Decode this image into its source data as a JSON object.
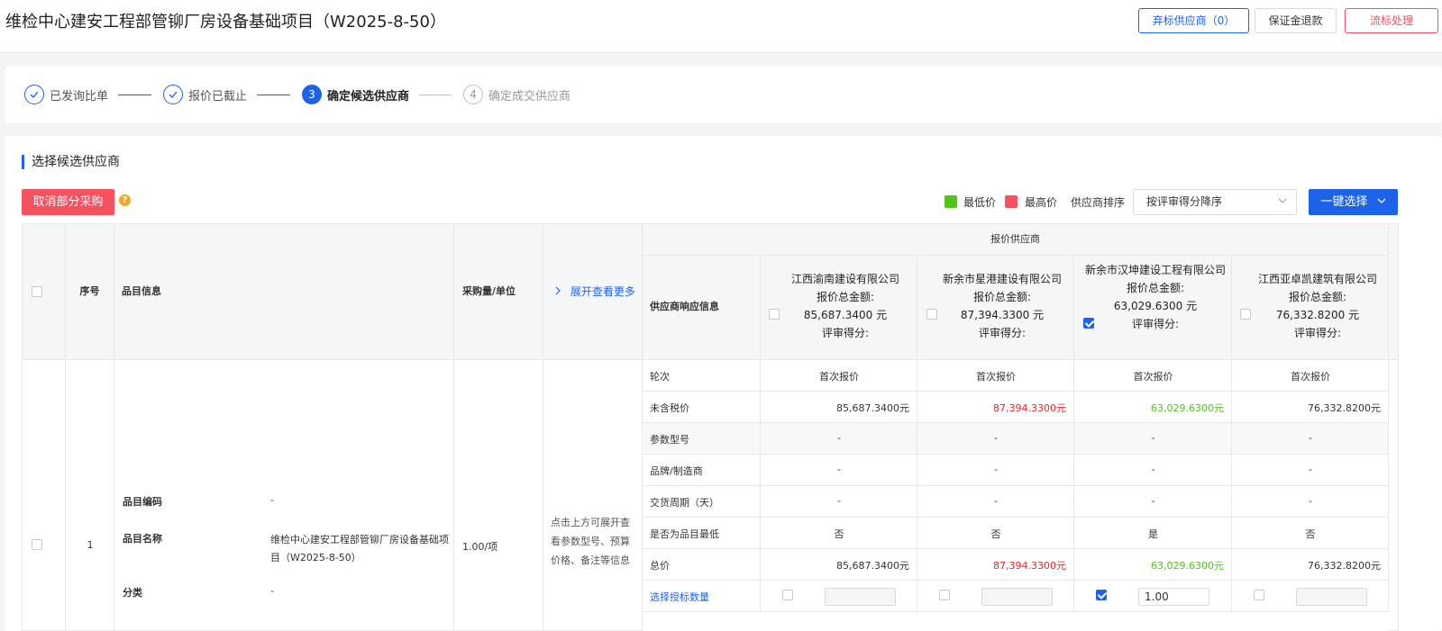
{
  "header": {
    "title": "维检中心建安工程部管铆厂房设备基础项目（W2025-8-50）",
    "btn_abandon": "弃标供应商（0）",
    "btn_refund": "保证金退款",
    "btn_fail": "流标处理"
  },
  "steps": [
    {
      "label": "已发询比单",
      "state": "done"
    },
    {
      "label": "报价已截止",
      "state": "done"
    },
    {
      "label": "确定候选供应商",
      "state": "active",
      "num": "3"
    },
    {
      "label": "确定成交供应商",
      "state": "todo",
      "num": "4"
    }
  ],
  "section": {
    "title": "选择候选供应商",
    "cancel_btn": "取消部分采购",
    "legend_low": "最低价",
    "legend_high": "最高价",
    "sort_label": "供应商排序",
    "sort_value": "按评审得分降序",
    "one_click": "一键选择"
  },
  "colors": {
    "low": "#52c41a",
    "high": "#f5515f",
    "accent": "#1d63ea"
  },
  "table": {
    "headers": {
      "seq": "序号",
      "item_info": "品目信息",
      "qty_unit": "采购量/单位",
      "expand": "展开查看更多",
      "suppliers_group": "报价供应商",
      "resp_info": "供应商响应信息"
    },
    "suppliers": [
      {
        "name": "江西渝南建设有限公司",
        "total_label": "报价总金额:",
        "total": "85,687.3400 元",
        "score_label": "评审得分:",
        "checked": false
      },
      {
        "name": "新余市星港建设有限公司",
        "total_label": "报价总金额:",
        "total": "87,394.3300 元",
        "score_label": "评审得分:",
        "checked": false
      },
      {
        "name": "新余市汉坤建设工程有限公司",
        "total_label": "报价总金额:",
        "total": "63,029.6300 元",
        "score_label": "评审得分:",
        "checked": true
      },
      {
        "name": "江西亚卓凯建筑有限公司",
        "total_label": "报价总金额:",
        "total": "76,332.8200 元",
        "score_label": "评审得分:",
        "checked": false
      }
    ],
    "row": {
      "seq": "1",
      "code_label": "品目编码",
      "code_value": "-",
      "name_label": "品目名称",
      "name_value_1": "维检中心建安工程部管铆厂房设备基础项",
      "name_value_2": "目（W2025-8-50）",
      "cat_label": "分类",
      "cat_value": "-",
      "qty": "1.00/项",
      "hint_1": "点击上方可展开查",
      "hint_2": "看参数型号、预算",
      "hint_3": "价格、备注等信息"
    },
    "resp_rows": [
      {
        "label": "轮次",
        "values": [
          "首次报价",
          "首次报价",
          "首次报价",
          "首次报价"
        ]
      },
      {
        "label": "未含税价",
        "values": [
          "85,687.3400元",
          "87,394.3300元",
          "63,029.6300元",
          "76,332.8200元"
        ]
      },
      {
        "label": "参数型号",
        "values": [
          "-",
          "-",
          "-",
          "-"
        ]
      },
      {
        "label": "品牌/制造商",
        "values": [
          "-",
          "-",
          "-",
          "-"
        ]
      },
      {
        "label": "交货周期（天）",
        "values": [
          "-",
          "-",
          "-",
          "-"
        ]
      },
      {
        "label": "是否为品目最低",
        "values": [
          "否",
          "否",
          "是",
          "否"
        ]
      },
      {
        "label": "总价",
        "values": [
          "85,687.3400元",
          "87,394.3300元",
          "63,029.6300元",
          "76,332.8200元"
        ]
      },
      {
        "label": "选择授标数量",
        "values": [
          "",
          "",
          "1.00",
          ""
        ]
      }
    ]
  }
}
